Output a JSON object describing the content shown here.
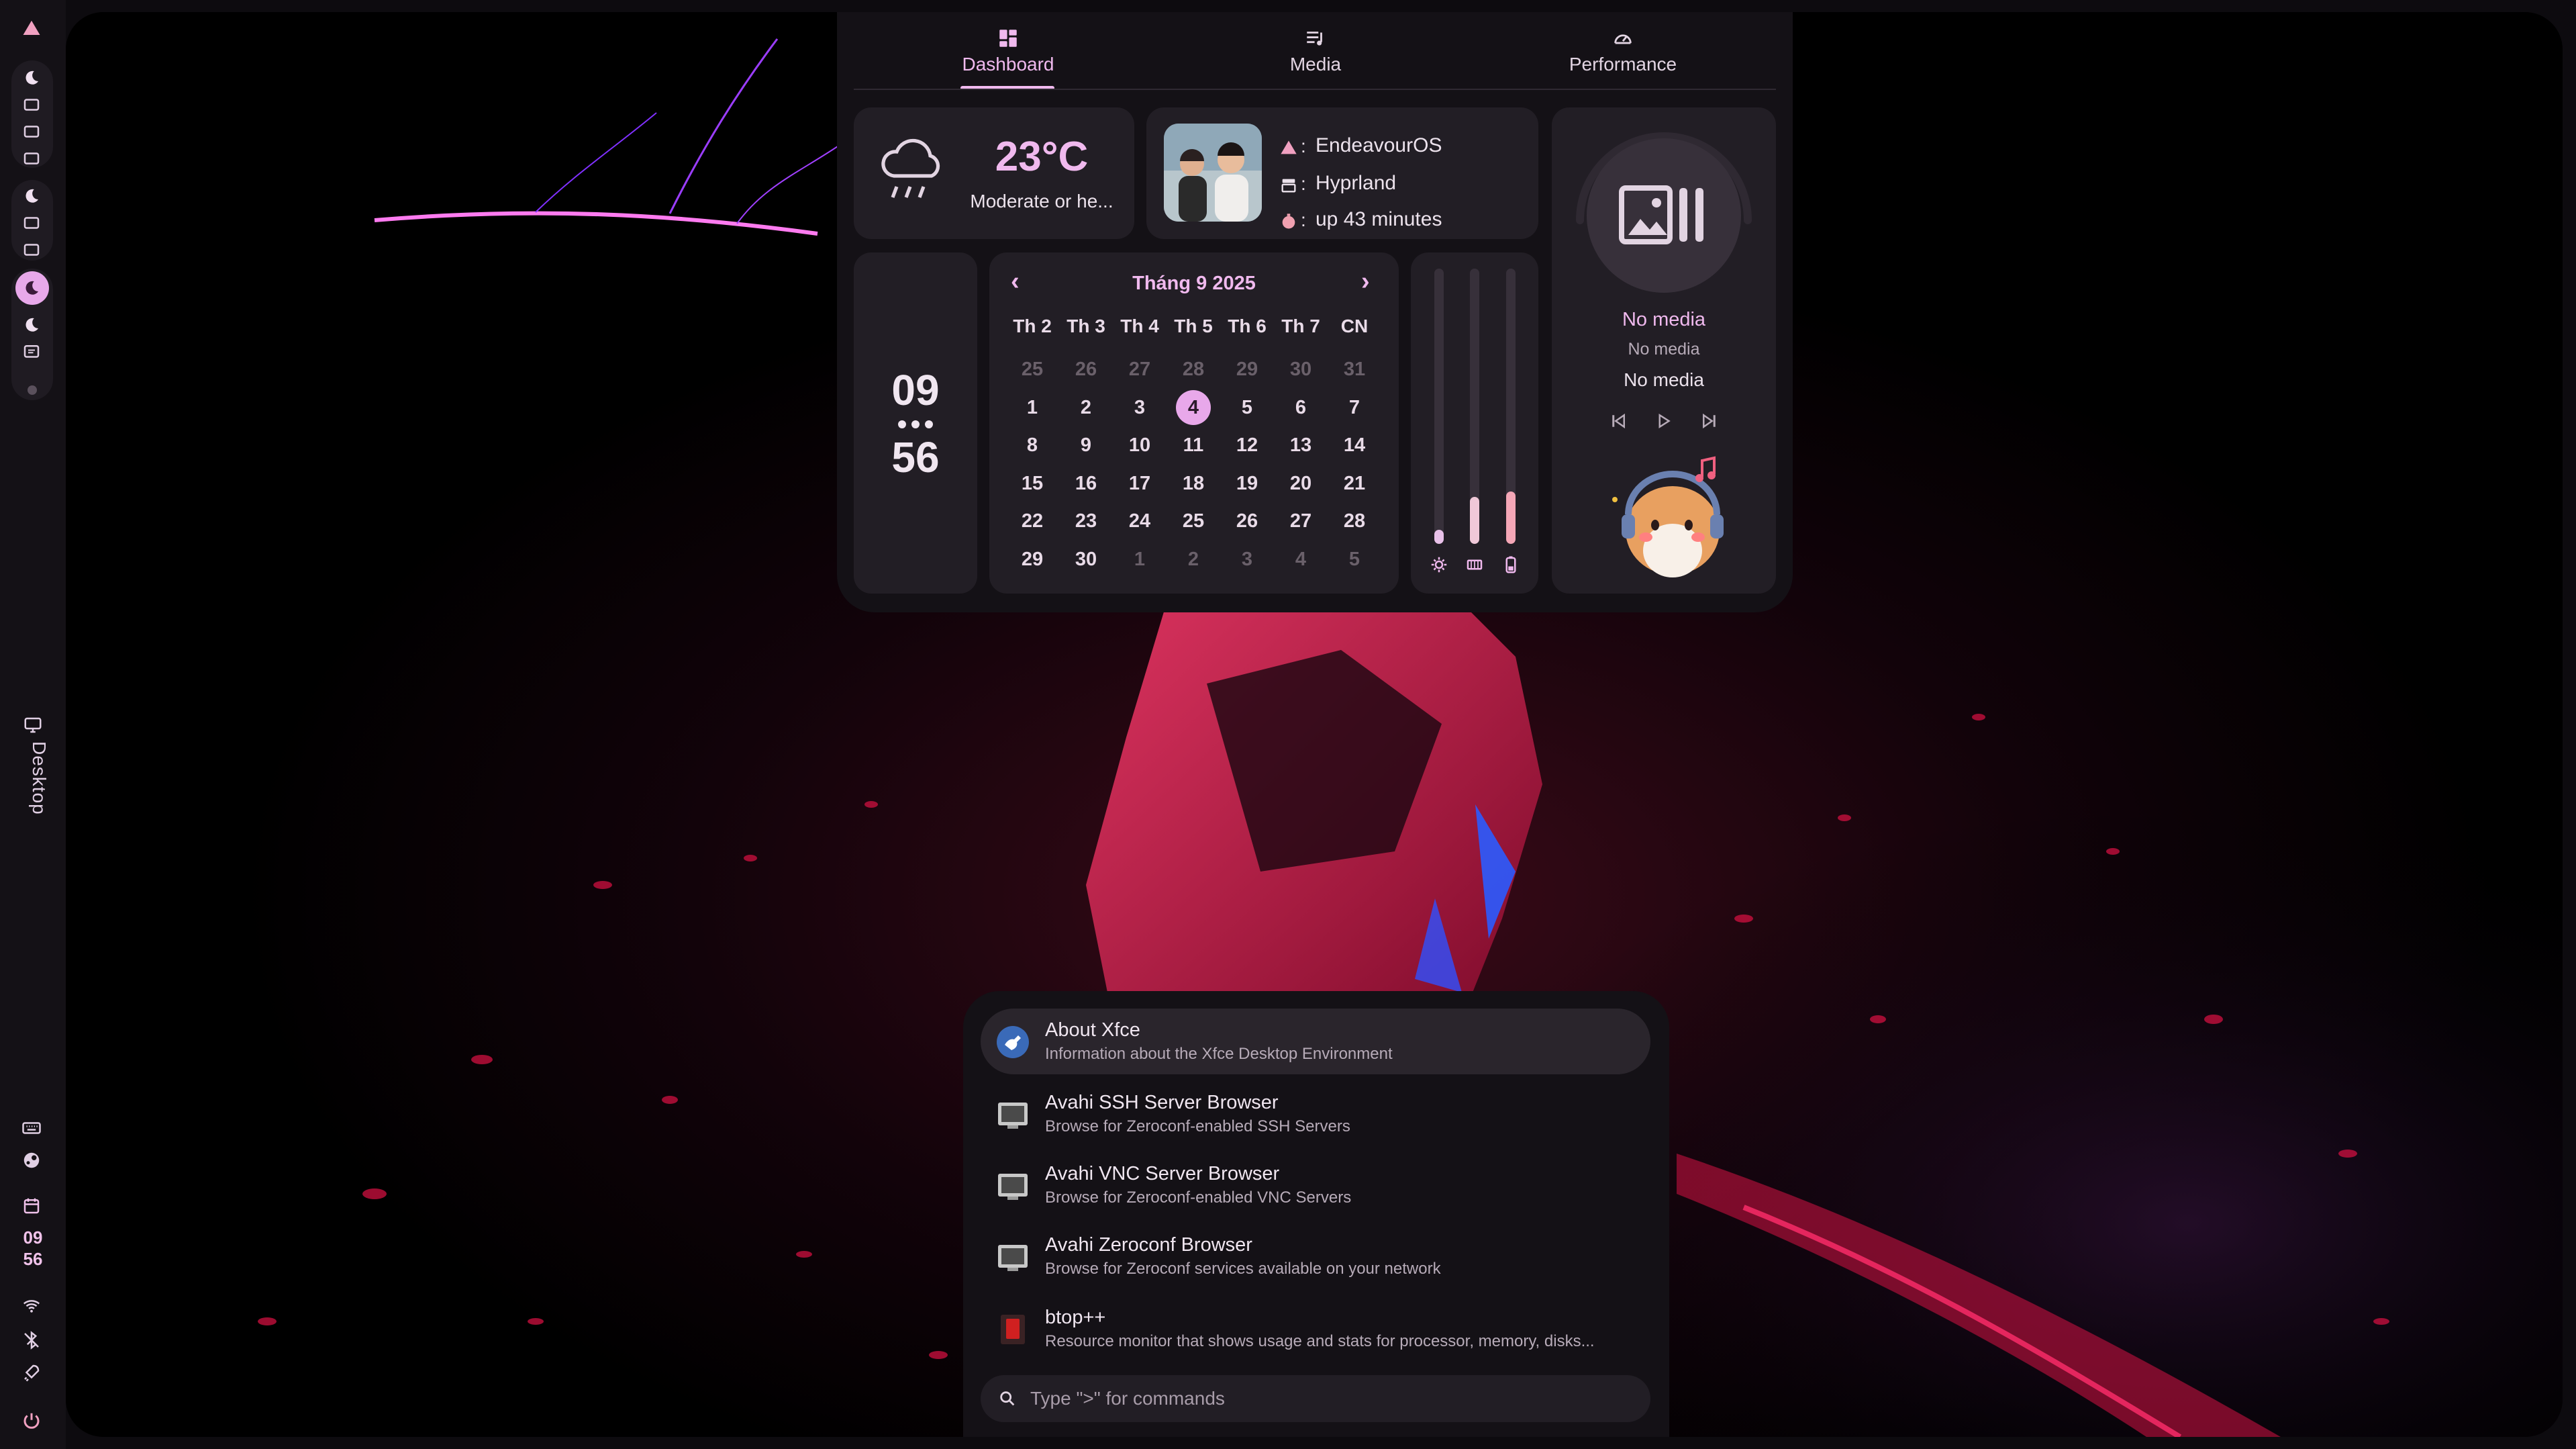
{
  "tabs": [
    {
      "label": "Dashboard",
      "icon": "dashboard-icon",
      "active": true
    },
    {
      "label": "Media",
      "icon": "playlist-icon"
    },
    {
      "label": "Performance",
      "icon": "speedometer-icon"
    }
  ],
  "weather": {
    "temp": "23°C",
    "desc": "Moderate or he...",
    "icon": "rain-cloud-icon"
  },
  "system": {
    "os": "EndeavourOS",
    "wm": "Hyprland",
    "uptime": "up 43 minutes",
    "sep": ":"
  },
  "clock": {
    "hour": "09",
    "minute": "56"
  },
  "calendar": {
    "title": "Tháng 9 2025",
    "weekdays": [
      "Th 2",
      "Th 3",
      "Th 4",
      "Th 5",
      "Th 6",
      "Th 7",
      "CN"
    ],
    "weeks": [
      [
        "25",
        "26",
        "27",
        "28",
        "29",
        "30",
        "31"
      ],
      [
        "1",
        "2",
        "3",
        "4",
        "5",
        "6",
        "7"
      ],
      [
        "8",
        "9",
        "10",
        "11",
        "12",
        "13",
        "14"
      ],
      [
        "15",
        "16",
        "17",
        "18",
        "19",
        "20",
        "21"
      ],
      [
        "22",
        "23",
        "24",
        "25",
        "26",
        "27",
        "28"
      ],
      [
        "29",
        "30",
        "1",
        "2",
        "3",
        "4",
        "5"
      ]
    ],
    "today": "4"
  },
  "sliders": [
    {
      "name": "brightness",
      "icon": "brightness-icon",
      "level": 0.05
    },
    {
      "name": "memory",
      "icon": "memory-icon",
      "level": 0.17
    },
    {
      "name": "battery",
      "icon": "battery-icon",
      "level": 0.19
    }
  ],
  "media": {
    "title": "No media",
    "artist": "No media",
    "album": "No media"
  },
  "bar": {
    "clock_h": "09",
    "clock_m": "56",
    "workspace_label": "Desktop"
  },
  "launcher": {
    "items": [
      {
        "name": "About Xfce",
        "desc": "Information about the Xfce Desktop Environment",
        "icon": "xfce-icon"
      },
      {
        "name": "Avahi SSH Server Browser",
        "desc": "Browse for Zeroconf-enabled SSH Servers",
        "icon": "network-server-icon"
      },
      {
        "name": "Avahi VNC Server Browser",
        "desc": "Browse for Zeroconf-enabled VNC Servers",
        "icon": "network-server-icon"
      },
      {
        "name": "Avahi Zeroconf Browser",
        "desc": "Browse for Zeroconf services available on your network",
        "icon": "network-server-icon"
      },
      {
        "name": "btop++",
        "desc": "Resource monitor that shows usage and stats for processor, memory, disks...",
        "icon": "btop-icon"
      }
    ],
    "placeholder": "Type \">\" for commands"
  },
  "colors": {
    "accent": "#f0b9ee",
    "surface": "#141116",
    "card": "#221e25",
    "slider_pink": "#f4a6b6"
  }
}
